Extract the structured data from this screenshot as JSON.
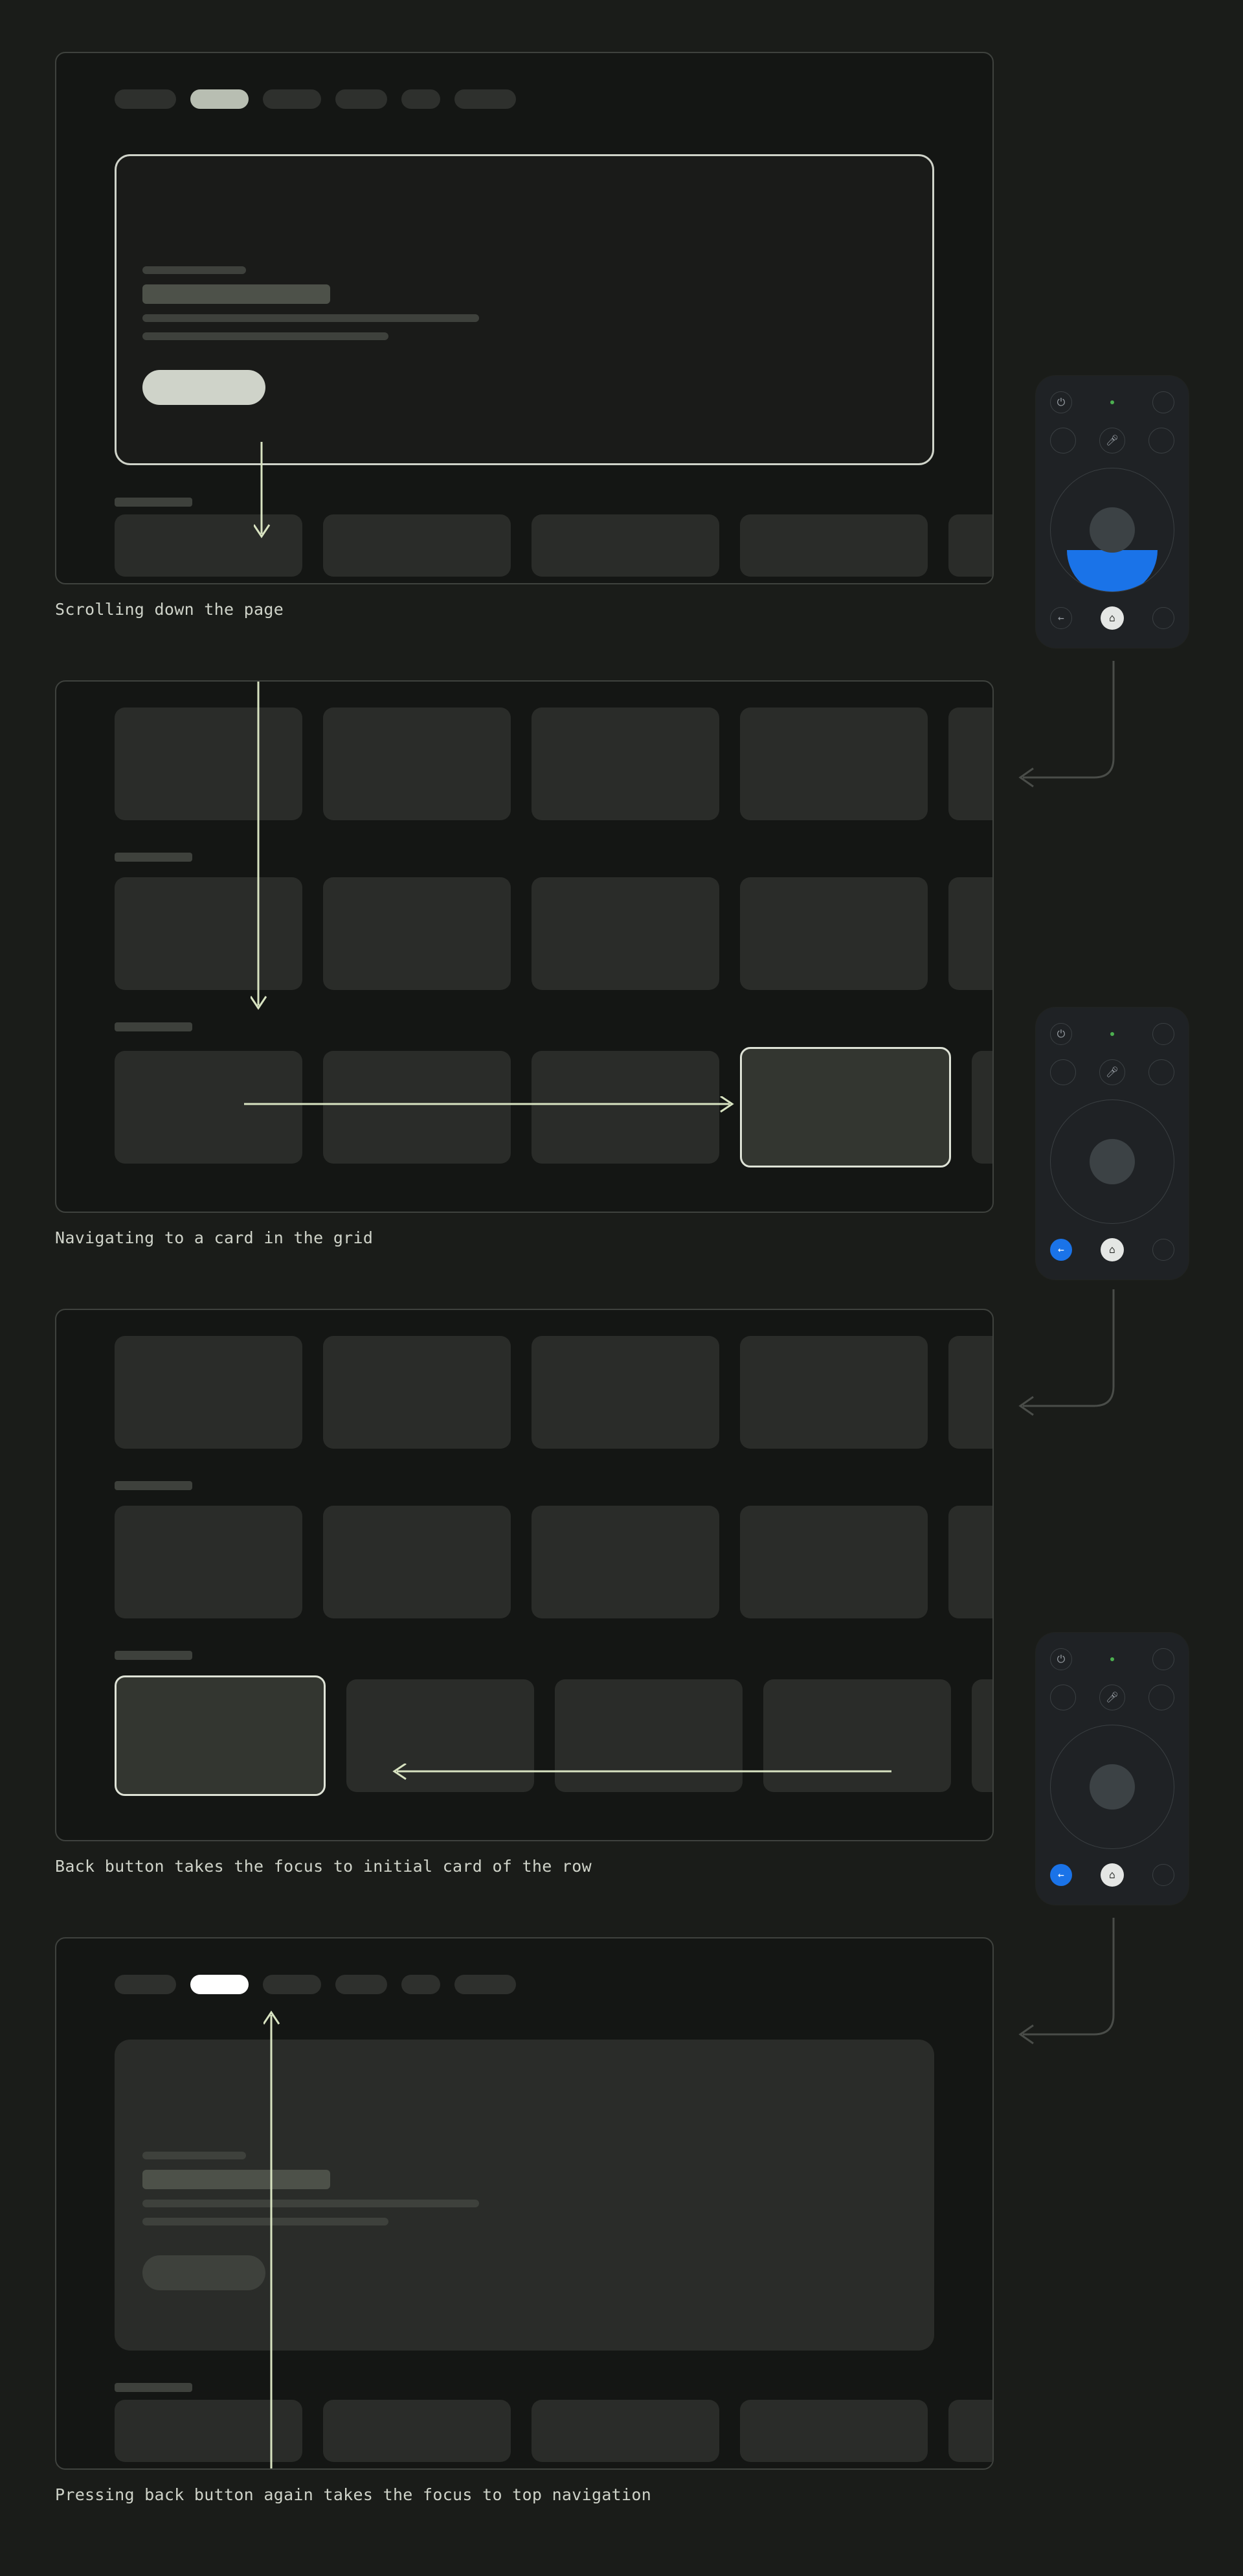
{
  "captions": {
    "s1": "Scrolling down the page",
    "s2": "Navigating to a card in the grid",
    "s3": "Back button takes the focus to initial card of the row",
    "s4": "Pressing back button again takes the focus to top navigation"
  },
  "remote": {
    "power_icon": "power-icon",
    "assist_icon": "mic-icon",
    "back_icon": "arrow-left-icon",
    "home_icon": "home-icon",
    "indicator": "led-green"
  },
  "panels": {
    "tabs_count": 6,
    "active_tab_index": 1,
    "hero": {
      "has_cta": true
    },
    "grid": {
      "rows": 3,
      "cards_per_row": 5
    }
  },
  "actions": {
    "s1": {
      "remote_highlight": "dpad-down"
    },
    "s2": {
      "remote_highlight": "back-button",
      "focused_card": {
        "row": 2,
        "col": 3
      }
    },
    "s3": {
      "remote_highlight": "back-button",
      "focused_card": {
        "row": 2,
        "col": 0
      }
    },
    "s4": {
      "remote_highlight": "none",
      "focused_tab": 1
    }
  }
}
